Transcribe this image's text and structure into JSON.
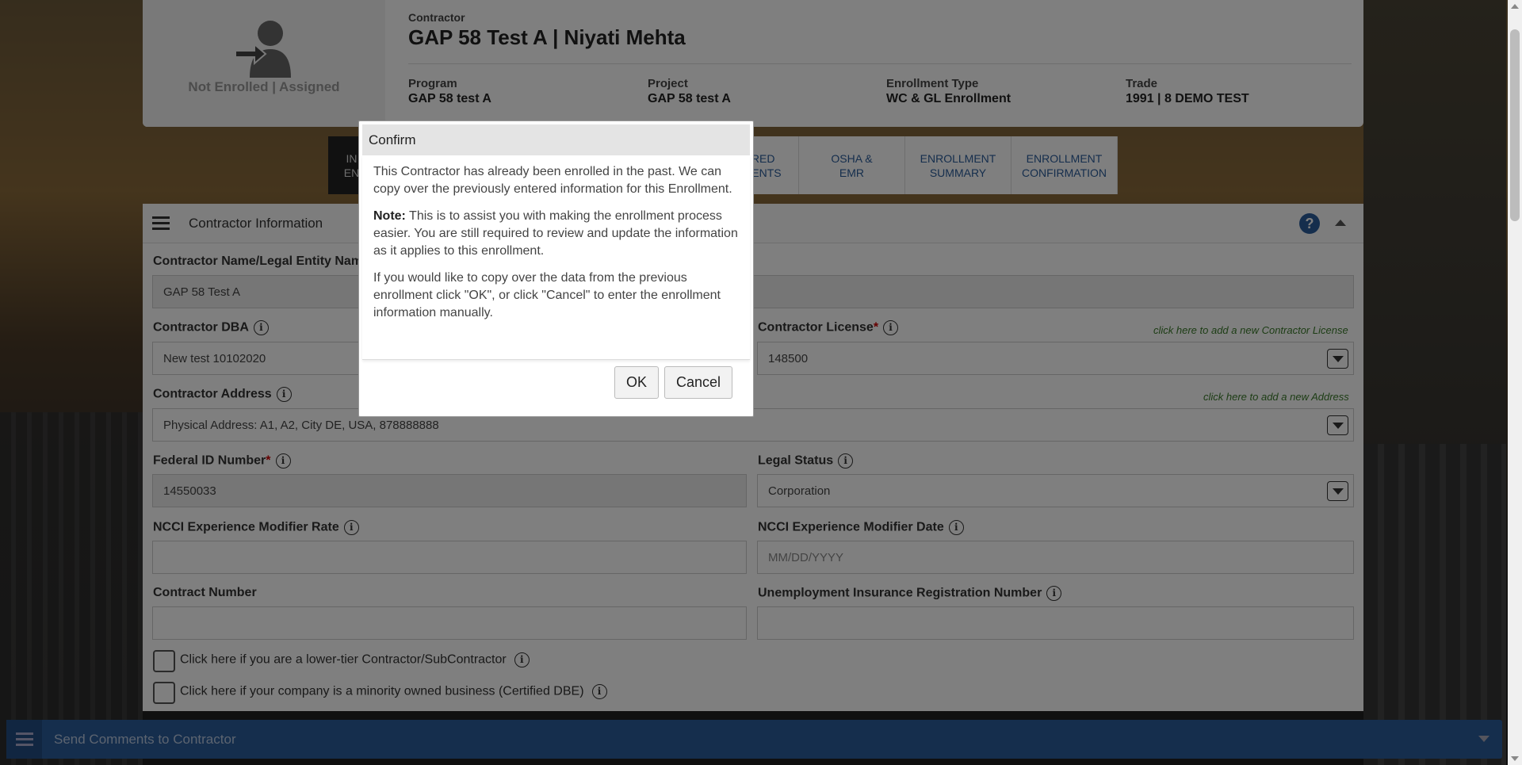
{
  "header": {
    "status": "Not Enrolled | Assigned",
    "contractor_caption": "Contractor",
    "contractor_title": "GAP 58 Test A | Niyati Mehta",
    "program_caption": "Program",
    "program_value": "GAP 58 test A",
    "project_caption": "Project",
    "project_value": "GAP 58 test A",
    "enrollment_type_caption": "Enrollment Type",
    "enrollment_type_value": "WC & GL Enrollment",
    "trade_caption": "Trade",
    "trade_value": "1991 | 8 DEMO TEST"
  },
  "tabs": [
    {
      "label": "IN\nEN"
    },
    {
      "label": "REQUIRED\nDOCUMENTS"
    },
    {
      "label": "OSHA &\nEMR"
    },
    {
      "label": "ENROLLMENT\nSUMMARY"
    },
    {
      "label": "ENROLLMENT\nCONFIRMATION"
    }
  ],
  "panel": {
    "title": "Contractor Information",
    "help_glyph": "?",
    "info_glyph": "i",
    "fields": {
      "legal_name_label": "Contractor Name/Legal Entity Name",
      "legal_name_value": "GAP 58 Test A",
      "dba_label": "Contractor DBA",
      "dba_value": "New test 10102020",
      "license_label": "Contractor License",
      "license_value": "148500",
      "license_link": "click here to add a new Contractor License",
      "address_label": "Contractor Address",
      "address_value": "Physical Address: A1, A2, City DE, USA, 878888888",
      "address_link": "click here to add a new Address",
      "fein_label": "Federal ID Number",
      "fein_value": "14550033",
      "legal_status_label": "Legal Status",
      "legal_status_value": "Corporation",
      "ncci_rate_label": "NCCI Experience Modifier Rate",
      "ncci_rate_value": "",
      "ncci_date_label": "NCCI Experience Modifier Date",
      "ncci_date_placeholder": "MM/DD/YYYY",
      "contract_number_label": "Contract Number",
      "contract_number_value": "",
      "unemployment_label": "Unemployment Insurance Registration Number",
      "unemployment_value": "",
      "lower_tier_label": "Click here if you are a lower-tier Contractor/SubContractor",
      "minority_label": "Click here if your company is a minority owned business (Certified DBE)"
    }
  },
  "footer": {
    "label": "Send Comments to Contractor"
  },
  "modal": {
    "title": "Confirm",
    "para1": "This Contractor has already been enrolled in the past. We can copy over the previously entered information for this Enrollment.",
    "note_label": "Note:",
    "para2": " This is to assist you with making the enrollment process easier. You are still required to review and update the information as it applies to this enrollment.",
    "para3": "If you would like to copy over the data from the previous enrollment click \"OK\", or click \"Cancel\" to enter the enrollment information manually.",
    "ok_label": "OK",
    "cancel_label": "Cancel"
  },
  "colors": {
    "accent": "#2a5c9a",
    "required": "#cc0000",
    "link_green": "#3a7a2a"
  }
}
